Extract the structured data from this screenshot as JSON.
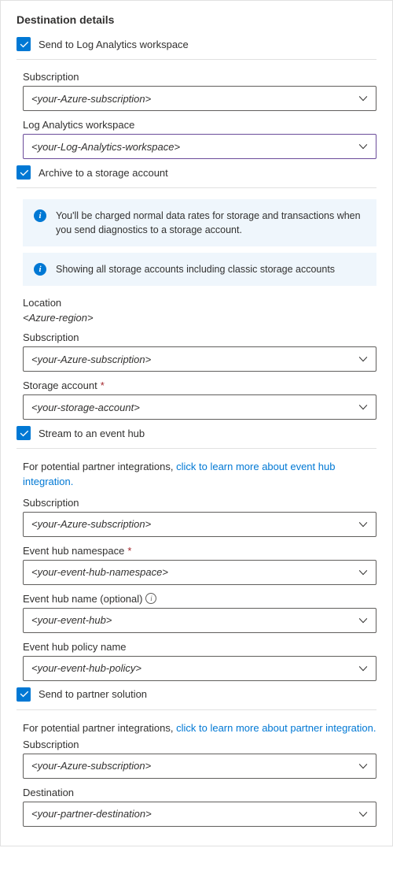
{
  "header": "Destination details",
  "sendLogAnalytics": {
    "label": "Send to Log Analytics workspace",
    "subscription": {
      "label": "Subscription",
      "value": "<your-Azure-subscription>"
    },
    "workspace": {
      "label": "Log Analytics workspace",
      "value": "<your-Log-Analytics-workspace>"
    }
  },
  "archiveStorage": {
    "label": "Archive to a storage account",
    "info1": "You'll be charged normal data rates for storage and transactions when you send diagnostics to a storage account.",
    "info2": "Showing all storage accounts including classic storage accounts",
    "location": {
      "label": "Location",
      "value": "<Azure-region>"
    },
    "subscription": {
      "label": "Subscription",
      "value": "<your-Azure-subscription>"
    },
    "storageAccount": {
      "label": "Storage account",
      "value": "<your-storage-account>"
    }
  },
  "streamEventHub": {
    "label": "Stream to an event hub",
    "helper_prefix": "For potential partner integrations, ",
    "helper_link": "click to learn more about event hub integration.",
    "subscription": {
      "label": "Subscription",
      "value": "<your-Azure-subscription>"
    },
    "namespace": {
      "label": "Event hub namespace",
      "value": "<your-event-hub-namespace>"
    },
    "hubName": {
      "label": "Event hub name (optional)",
      "value": "<your-event-hub>"
    },
    "policyName": {
      "label": "Event hub policy name",
      "value": "<your-event-hub-policy>"
    }
  },
  "partnerSolution": {
    "label": "Send to partner solution",
    "helper_prefix": "For potential partner integrations, ",
    "helper_link": "click to learn more about partner integration.",
    "subscription": {
      "label": "Subscription",
      "value": "<your-Azure-subscription>"
    },
    "destination": {
      "label": "Destination",
      "value": "<your-partner-destination>"
    }
  }
}
